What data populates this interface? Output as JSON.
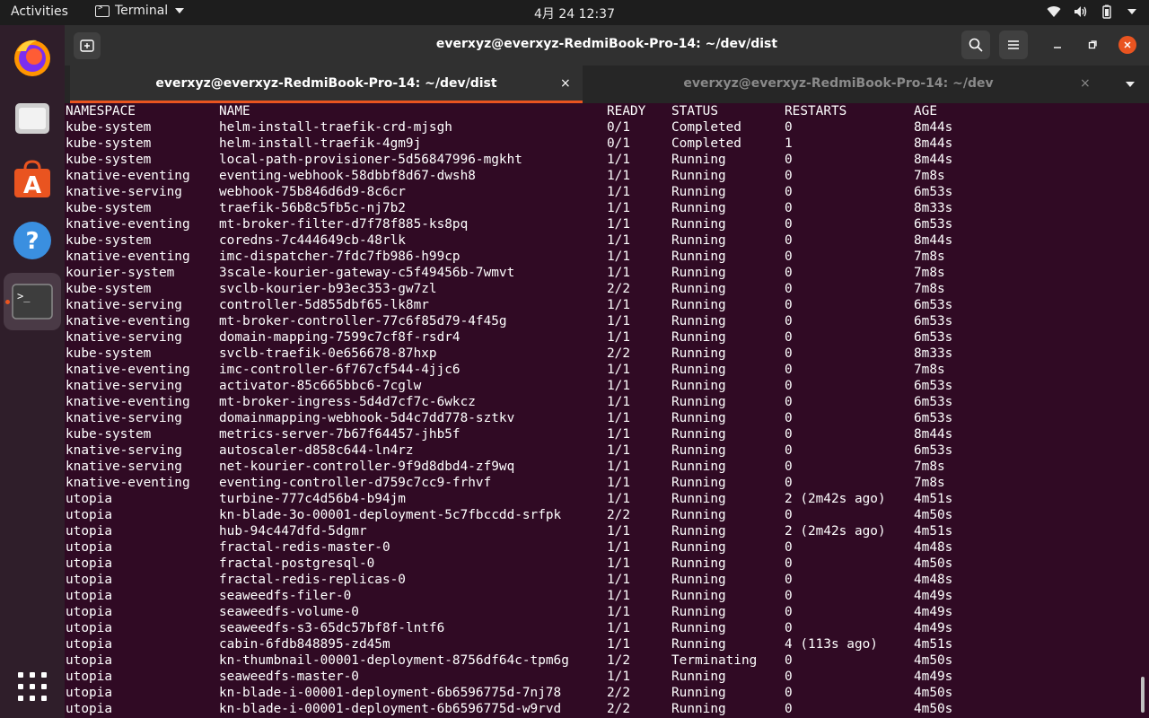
{
  "topbar": {
    "activities": "Activities",
    "app_name": "Terminal",
    "clock": "4月 24  12:37",
    "icons": [
      "wifi-icon",
      "volume-icon",
      "battery-icon",
      "power-menu-caret-icon"
    ]
  },
  "dock": {
    "items": [
      "firefox",
      "files",
      "ubuntu-software",
      "help",
      "terminal"
    ],
    "active": "terminal"
  },
  "window": {
    "title": "everxyz@everxyz-RedmiBook-Pro-14: ~/dev/dist",
    "tabs": [
      {
        "label": "everxyz@everxyz-RedmiBook-Pro-14: ~/dev/dist",
        "active": true
      },
      {
        "label": "everxyz@everxyz-RedmiBook-Pro-14: ~/dev",
        "active": false
      }
    ],
    "close_glyph": "×"
  },
  "colors": {
    "accent": "#e95420",
    "terminal_bg": "#300a24",
    "titlebar": "#303030"
  },
  "terminal": {
    "headers": [
      "NAMESPACE",
      "NAME",
      "READY",
      "STATUS",
      "RESTARTS",
      "AGE"
    ],
    "rows": [
      [
        "kube-system",
        "helm-install-traefik-crd-mjsgh",
        "0/1",
        "Completed",
        "0",
        "8m44s"
      ],
      [
        "kube-system",
        "helm-install-traefik-4gm9j",
        "0/1",
        "Completed",
        "1",
        "8m44s"
      ],
      [
        "kube-system",
        "local-path-provisioner-5d56847996-mgkht",
        "1/1",
        "Running",
        "0",
        "8m44s"
      ],
      [
        "knative-eventing",
        "eventing-webhook-58dbbf8d67-dwsh8",
        "1/1",
        "Running",
        "0",
        "7m8s"
      ],
      [
        "knative-serving",
        "webhook-75b846d6d9-8c6cr",
        "1/1",
        "Running",
        "0",
        "6m53s"
      ],
      [
        "kube-system",
        "traefik-56b8c5fb5c-nj7b2",
        "1/1",
        "Running",
        "0",
        "8m33s"
      ],
      [
        "knative-eventing",
        "mt-broker-filter-d7f78f885-ks8pq",
        "1/1",
        "Running",
        "0",
        "6m53s"
      ],
      [
        "kube-system",
        "coredns-7c444649cb-48rlk",
        "1/1",
        "Running",
        "0",
        "8m44s"
      ],
      [
        "knative-eventing",
        "imc-dispatcher-7fdc7fb986-h99cp",
        "1/1",
        "Running",
        "0",
        "7m8s"
      ],
      [
        "kourier-system",
        "3scale-kourier-gateway-c5f49456b-7wmvt",
        "1/1",
        "Running",
        "0",
        "7m8s"
      ],
      [
        "kube-system",
        "svclb-kourier-b93ec353-gw7zl",
        "2/2",
        "Running",
        "0",
        "7m8s"
      ],
      [
        "knative-serving",
        "controller-5d855dbf65-lk8mr",
        "1/1",
        "Running",
        "0",
        "6m53s"
      ],
      [
        "knative-eventing",
        "mt-broker-controller-77c6f85d79-4f45g",
        "1/1",
        "Running",
        "0",
        "6m53s"
      ],
      [
        "knative-serving",
        "domain-mapping-7599c7cf8f-rsdr4",
        "1/1",
        "Running",
        "0",
        "6m53s"
      ],
      [
        "kube-system",
        "svclb-traefik-0e656678-87hxp",
        "2/2",
        "Running",
        "0",
        "8m33s"
      ],
      [
        "knative-eventing",
        "imc-controller-6f767cf544-4jjc6",
        "1/1",
        "Running",
        "0",
        "7m8s"
      ],
      [
        "knative-serving",
        "activator-85c665bbc6-7cglw",
        "1/1",
        "Running",
        "0",
        "6m53s"
      ],
      [
        "knative-eventing",
        "mt-broker-ingress-5d4d7cf7c-6wkcz",
        "1/1",
        "Running",
        "0",
        "6m53s"
      ],
      [
        "knative-serving",
        "domainmapping-webhook-5d4c7dd778-sztkv",
        "1/1",
        "Running",
        "0",
        "6m53s"
      ],
      [
        "kube-system",
        "metrics-server-7b67f64457-jhb5f",
        "1/1",
        "Running",
        "0",
        "8m44s"
      ],
      [
        "knative-serving",
        "autoscaler-d858c644-ln4rz",
        "1/1",
        "Running",
        "0",
        "6m53s"
      ],
      [
        "knative-serving",
        "net-kourier-controller-9f9d8dbd4-zf9wq",
        "1/1",
        "Running",
        "0",
        "7m8s"
      ],
      [
        "knative-eventing",
        "eventing-controller-d759c7cc9-frhvf",
        "1/1",
        "Running",
        "0",
        "7m8s"
      ],
      [
        "utopia",
        "turbine-777c4d56b4-b94jm",
        "1/1",
        "Running",
        "2 (2m42s ago)",
        "4m51s"
      ],
      [
        "utopia",
        "kn-blade-3o-00001-deployment-5c7fbccdd-srfpk",
        "2/2",
        "Running",
        "0",
        "4m50s"
      ],
      [
        "utopia",
        "hub-94c447dfd-5dgmr",
        "1/1",
        "Running",
        "2 (2m42s ago)",
        "4m51s"
      ],
      [
        "utopia",
        "fractal-redis-master-0",
        "1/1",
        "Running",
        "0",
        "4m48s"
      ],
      [
        "utopia",
        "fractal-postgresql-0",
        "1/1",
        "Running",
        "0",
        "4m50s"
      ],
      [
        "utopia",
        "fractal-redis-replicas-0",
        "1/1",
        "Running",
        "0",
        "4m48s"
      ],
      [
        "utopia",
        "seaweedfs-filer-0",
        "1/1",
        "Running",
        "0",
        "4m49s"
      ],
      [
        "utopia",
        "seaweedfs-volume-0",
        "1/1",
        "Running",
        "0",
        "4m49s"
      ],
      [
        "utopia",
        "seaweedfs-s3-65dc57bf8f-lntf6",
        "1/1",
        "Running",
        "0",
        "4m49s"
      ],
      [
        "utopia",
        "cabin-6fdb848895-zd45m",
        "1/1",
        "Running",
        "4 (113s ago)",
        "4m51s"
      ],
      [
        "utopia",
        "kn-thumbnail-00001-deployment-8756df64c-tpm6g",
        "1/2",
        "Terminating",
        "0",
        "4m50s"
      ],
      [
        "utopia",
        "seaweedfs-master-0",
        "1/1",
        "Running",
        "0",
        "4m49s"
      ],
      [
        "utopia",
        "kn-blade-i-00001-deployment-6b6596775d-7nj78",
        "2/2",
        "Running",
        "0",
        "4m50s"
      ],
      [
        "utopia",
        "kn-blade-i-00001-deployment-6b6596775d-w9rvd",
        "2/2",
        "Running",
        "0",
        "4m50s"
      ]
    ]
  }
}
